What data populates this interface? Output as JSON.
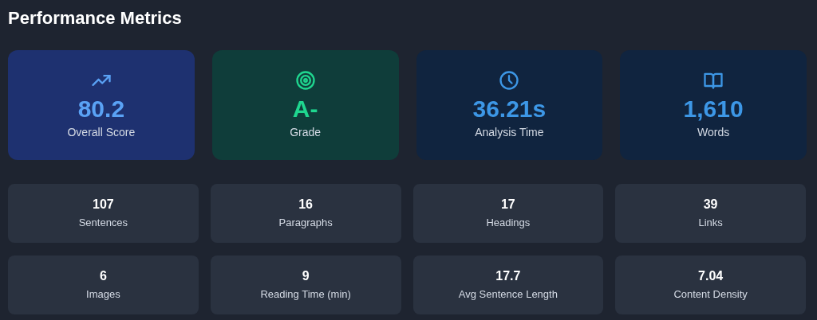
{
  "title": "Performance Metrics",
  "highlights": [
    {
      "kind": "trend",
      "value": "80.2",
      "label": "Overall Score",
      "color": "#5aa2f5"
    },
    {
      "kind": "target",
      "value": "A-",
      "label": "Grade",
      "color": "#1fd68f"
    },
    {
      "kind": "clock",
      "value": "36.21s",
      "label": "Analysis Time",
      "color": "#3d97e6"
    },
    {
      "kind": "book",
      "value": "1,610",
      "label": "Words",
      "color": "#3d97e6"
    }
  ],
  "stats": [
    {
      "value": "107",
      "label": "Sentences"
    },
    {
      "value": "16",
      "label": "Paragraphs"
    },
    {
      "value": "17",
      "label": "Headings"
    },
    {
      "value": "39",
      "label": "Links"
    },
    {
      "value": "6",
      "label": "Images"
    },
    {
      "value": "9",
      "label": "Reading Time (min)"
    },
    {
      "value": "17.7",
      "label": "Avg Sentence Length"
    },
    {
      "value": "7.04",
      "label": "Content Density"
    }
  ]
}
